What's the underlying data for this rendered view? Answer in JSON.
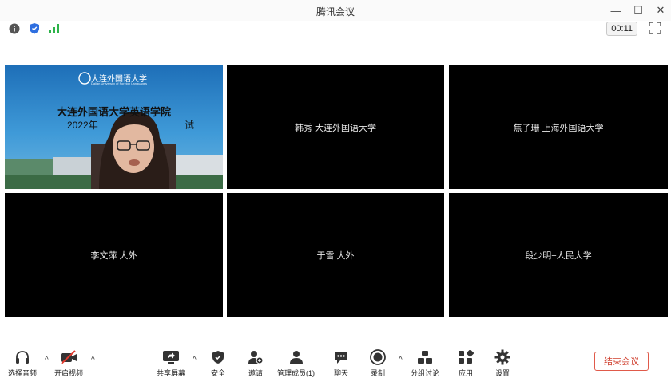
{
  "window": {
    "title": "腾讯会议",
    "minimize_glyph": "—",
    "maximize_glyph": "☐",
    "close_glyph": "✕"
  },
  "status": {
    "timer": "00:11",
    "icons": [
      "info-icon",
      "shield-icon",
      "signal-icon"
    ],
    "security_color": "#2f6fe0",
    "signal_color": "#2db34a"
  },
  "participants": [
    {
      "name": "",
      "video": true,
      "banner_title": "大连外国语大学英语学院",
      "banner_year": "2022年",
      "banner_suffix": "试",
      "logo_text": "大连外国语大学",
      "logo_subtext": "Dalian University of Foreign Languages"
    },
    {
      "name": "韩秀 大连外国语大学",
      "video": false
    },
    {
      "name": "焦子珊 上海外国语大学",
      "video": false
    },
    {
      "name": "李文萍 大外",
      "video": false
    },
    {
      "name": "于雪 大外",
      "video": false
    },
    {
      "name": "段少明+人民大学",
      "video": false
    }
  ],
  "toolbar": {
    "audio": "选择音频",
    "video": "开启视频",
    "share": "共享屏幕",
    "security": "安全",
    "invite": "邀请",
    "members": "管理成员(1)",
    "chat": "聊天",
    "record": "录制",
    "breakout": "分组讨论",
    "apps": "应用",
    "settings": "设置",
    "end_meeting": "结束会议",
    "caret_glyph": "^"
  },
  "colors": {
    "end_button": "#d0402f",
    "video_off_slash": "#e03a2e",
    "tile_background": "#000000"
  }
}
